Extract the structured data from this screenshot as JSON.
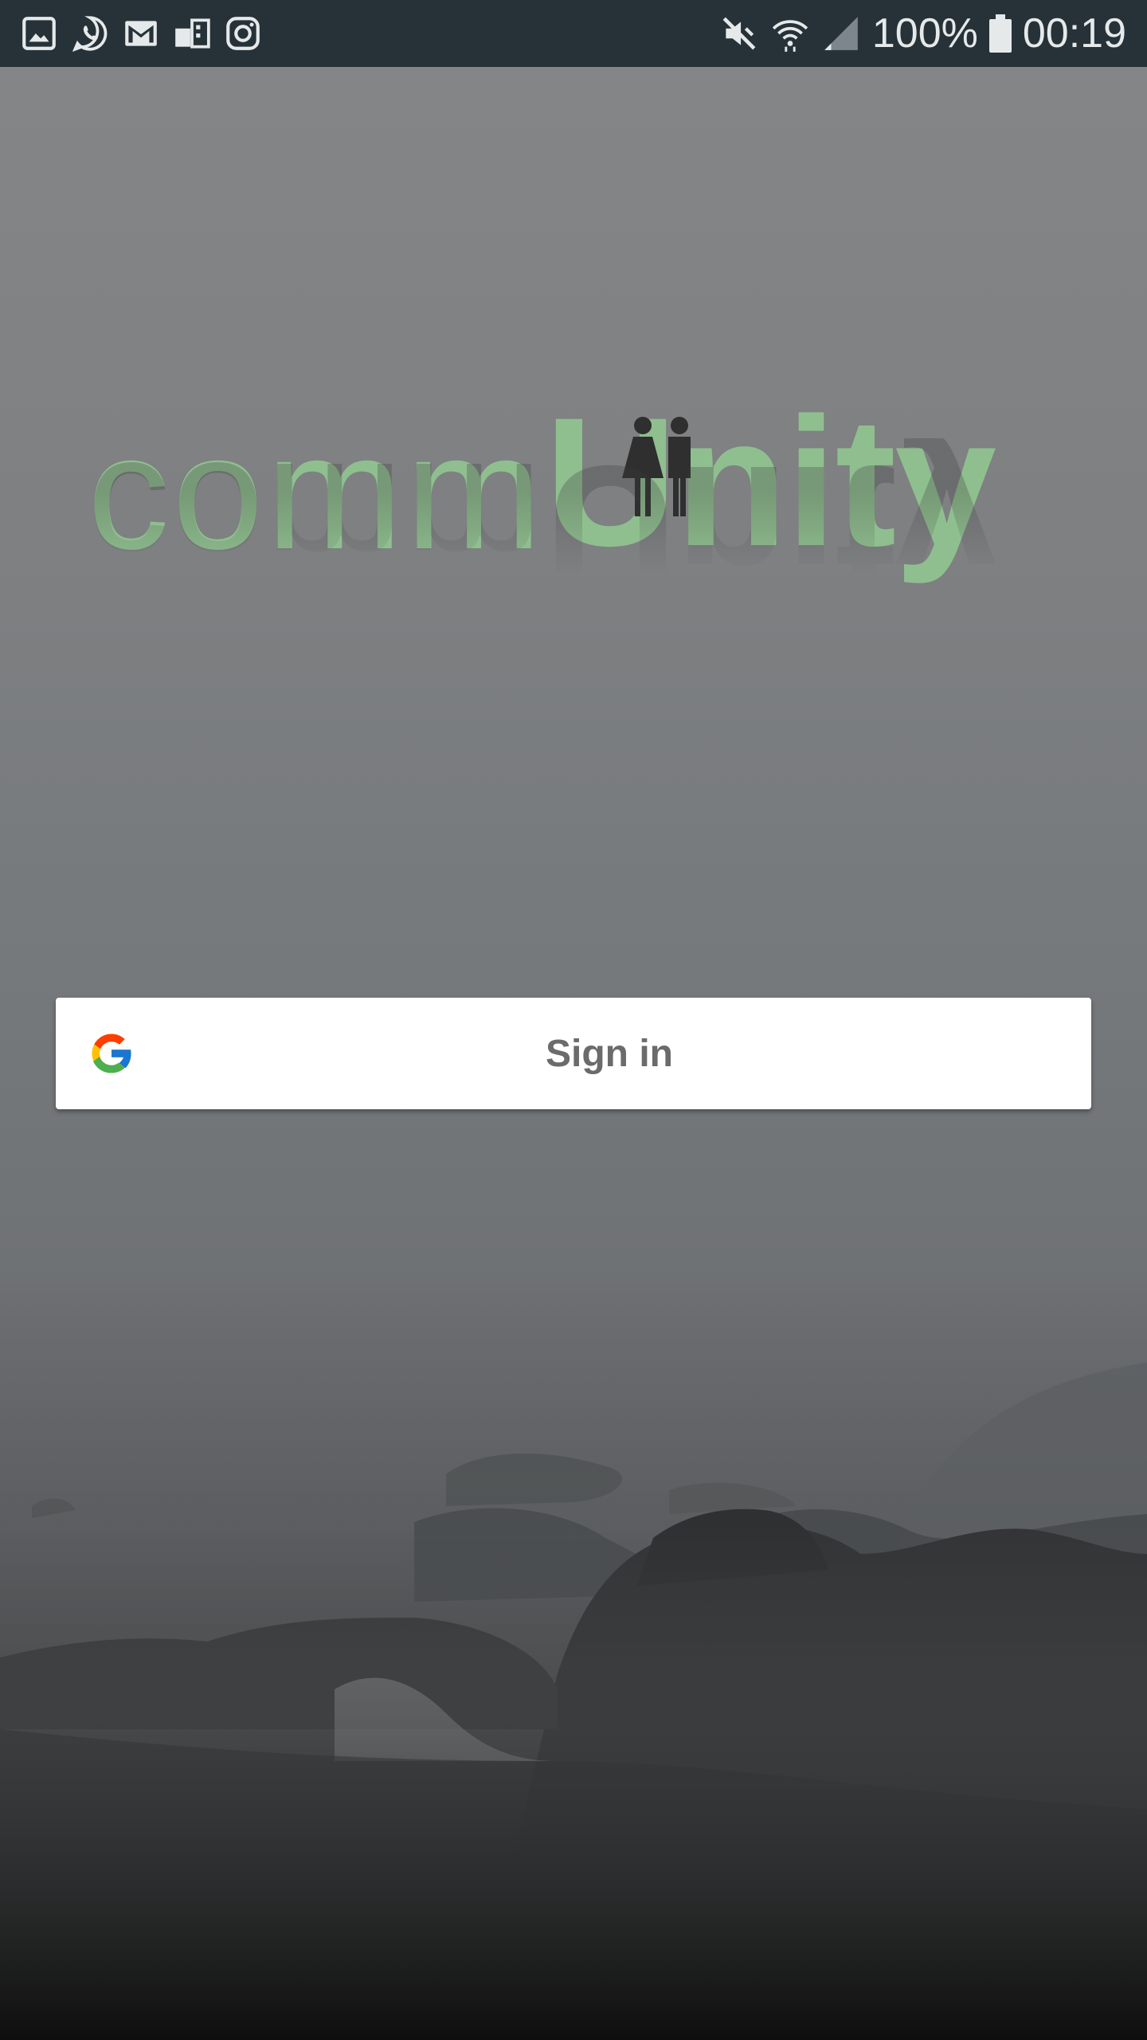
{
  "status_bar": {
    "battery_percent": "100%",
    "time": "00:19",
    "left_icons": [
      "gallery-icon",
      "whatsapp-icon",
      "gmail-icon",
      "cast-icon",
      "instagram-icon"
    ],
    "right_icons": [
      "mute-icon",
      "wifi-icon",
      "signal-icon",
      "battery-icon"
    ]
  },
  "logo": {
    "light_part": "comm",
    "bold_part": "Unity",
    "color": "#8fbf8f",
    "figures_icon": "couple-icon"
  },
  "signin_button": {
    "label": "Sign in",
    "icon": "google-icon"
  },
  "colors": {
    "status_bar": "#263238",
    "accent_green": "#8fbf8f",
    "button_text": "#6b6b6b"
  }
}
